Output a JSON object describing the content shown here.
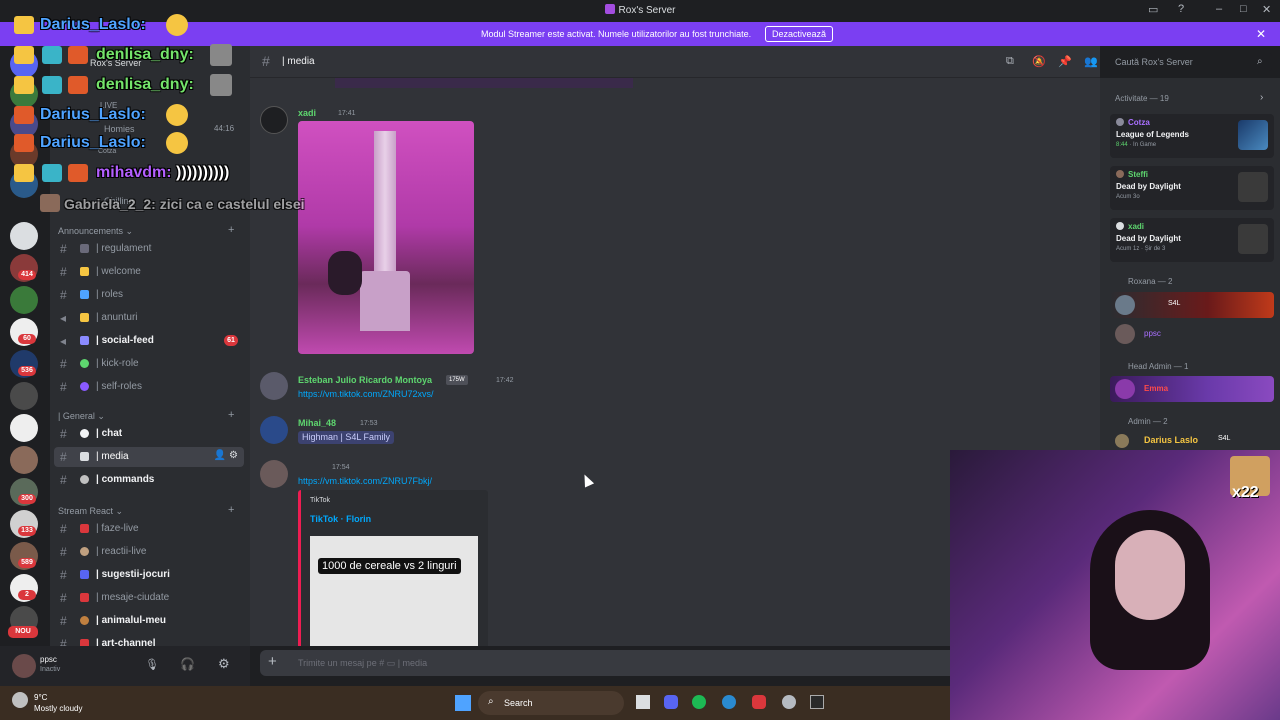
{
  "window": {
    "title": "Rox's Server"
  },
  "streamer_banner": {
    "text": "Modul Streamer este activat. Numele utilizatorilor au fost trunchiate.",
    "button": "Dezactivează"
  },
  "server_rail": {
    "badges": [
      "414",
      "60",
      "536",
      "300",
      "133",
      "589",
      "2"
    ],
    "new_label": "NOU"
  },
  "sidebar": {
    "server_name": "Rox's Server",
    "voice": {
      "live_label": "LIVE",
      "homies_label": "Homies",
      "homies_time": "44:16",
      "user": "Cotza",
      "chilling_label": "Chilling"
    },
    "categories": [
      {
        "name": "Announcements",
        "channels": [
          {
            "name": "| regulament",
            "unread": false
          },
          {
            "name": "| welcome",
            "unread": false
          },
          {
            "name": "| roles",
            "unread": false
          },
          {
            "name": "| anunturi",
            "unread": false
          },
          {
            "name": "| social-feed",
            "unread": true,
            "badge": "61"
          },
          {
            "name": "| kick-role",
            "unread": false
          },
          {
            "name": "| self-roles",
            "unread": false
          }
        ]
      },
      {
        "name": "| General",
        "channels": [
          {
            "name": "| chat",
            "unread": true
          },
          {
            "name": "| media",
            "unread": false,
            "active": true
          },
          {
            "name": "| commands",
            "unread": true
          }
        ]
      },
      {
        "name": "Stream React",
        "channels": [
          {
            "name": "| faze-live",
            "unread": false
          },
          {
            "name": "| reactii-live",
            "unread": false
          },
          {
            "name": "| sugestii-jocuri",
            "unread": true
          },
          {
            "name": "| mesaje-ciudate",
            "unread": false
          },
          {
            "name": "| animalul-meu",
            "unread": true
          },
          {
            "name": "| art-channel",
            "unread": true
          }
        ]
      }
    ],
    "user_panel": {
      "name": "ppsc",
      "status": "Inactiv"
    }
  },
  "channel_header": {
    "name": "| media",
    "search_placeholder": "Caută Rox's Server"
  },
  "messages": [
    {
      "author": "xadi",
      "time": "17:41",
      "color": "#5ed66f",
      "attachment": "image"
    },
    {
      "author": "Esteban Julio Ricardo Montoya",
      "tag": "175W",
      "time": "17:42",
      "color": "#5ed66f",
      "text": "https://vm.tiktok.com/ZNRU72xvs/"
    },
    {
      "author": "Mihai_48",
      "time": "17:53",
      "color": "#5ed66f",
      "text": "Highman | S4L Family"
    },
    {
      "author": "",
      "time": "17:54",
      "color": "#a970ff",
      "text": "https://vm.tiktok.com/ZNRU7Fbkj/",
      "embed": {
        "provider": "TikTok",
        "title": "TikTok · Florin",
        "caption": "1000 de cereale vs 2 linguri"
      }
    }
  ],
  "message_input": {
    "placeholder": "Trimite un mesaj pe #",
    "channel": "| media"
  },
  "member_list": {
    "activity_title": "Activitate — 19",
    "activities": [
      {
        "user": "Cotza",
        "game": "League of Legends",
        "detail": "8:44",
        "status": "In Game",
        "color": "#a970ff"
      },
      {
        "user": "Steffi",
        "game": "Dead by Daylight",
        "detail": "Acum 3o",
        "color": "#5ed66f"
      },
      {
        "user": "xadi",
        "game": "Dead by Daylight",
        "detail": "Acum 1z",
        "status": "Șir de 3",
        "color": "#5ed66f"
      }
    ],
    "roles": [
      {
        "name": "Roxana — 2",
        "members": [
          {
            "name": "",
            "tag": "S4L"
          },
          {
            "name": "ppsc"
          }
        ]
      },
      {
        "name": "Head Admin — 1",
        "members": [
          {
            "name": "Emma"
          }
        ]
      },
      {
        "name": "Admin — 2",
        "members": [
          {
            "name": "Darius Laslo",
            "tag": "S4L"
          }
        ]
      }
    ]
  },
  "stream_overlay": {
    "chat": [
      {
        "user": "Darius_Laslo:",
        "text": "",
        "color": "#4fa3ff"
      },
      {
        "user": "denlisa_dny:",
        "text": "",
        "color": "#74e36a"
      },
      {
        "user": "denlisa_dny:",
        "text": "",
        "color": "#74e36a"
      },
      {
        "user": "Darius_Laslo:",
        "text": "",
        "color": "#4fa3ff"
      },
      {
        "user": "Darius_Laslo:",
        "text": "",
        "color": "#4fa3ff"
      },
      {
        "user": "mihavdm:",
        "text": "))))))))))",
        "color": "#b45fff"
      },
      {
        "user": "Gabriela_2_2:",
        "text": "zici ca e castelul elsei",
        "color": "#cfcfcf"
      }
    ],
    "sub_count": "x22"
  },
  "taskbar": {
    "weather_temp": "9°C",
    "weather_desc": "Mostly cloudy",
    "search_label": "Search"
  }
}
